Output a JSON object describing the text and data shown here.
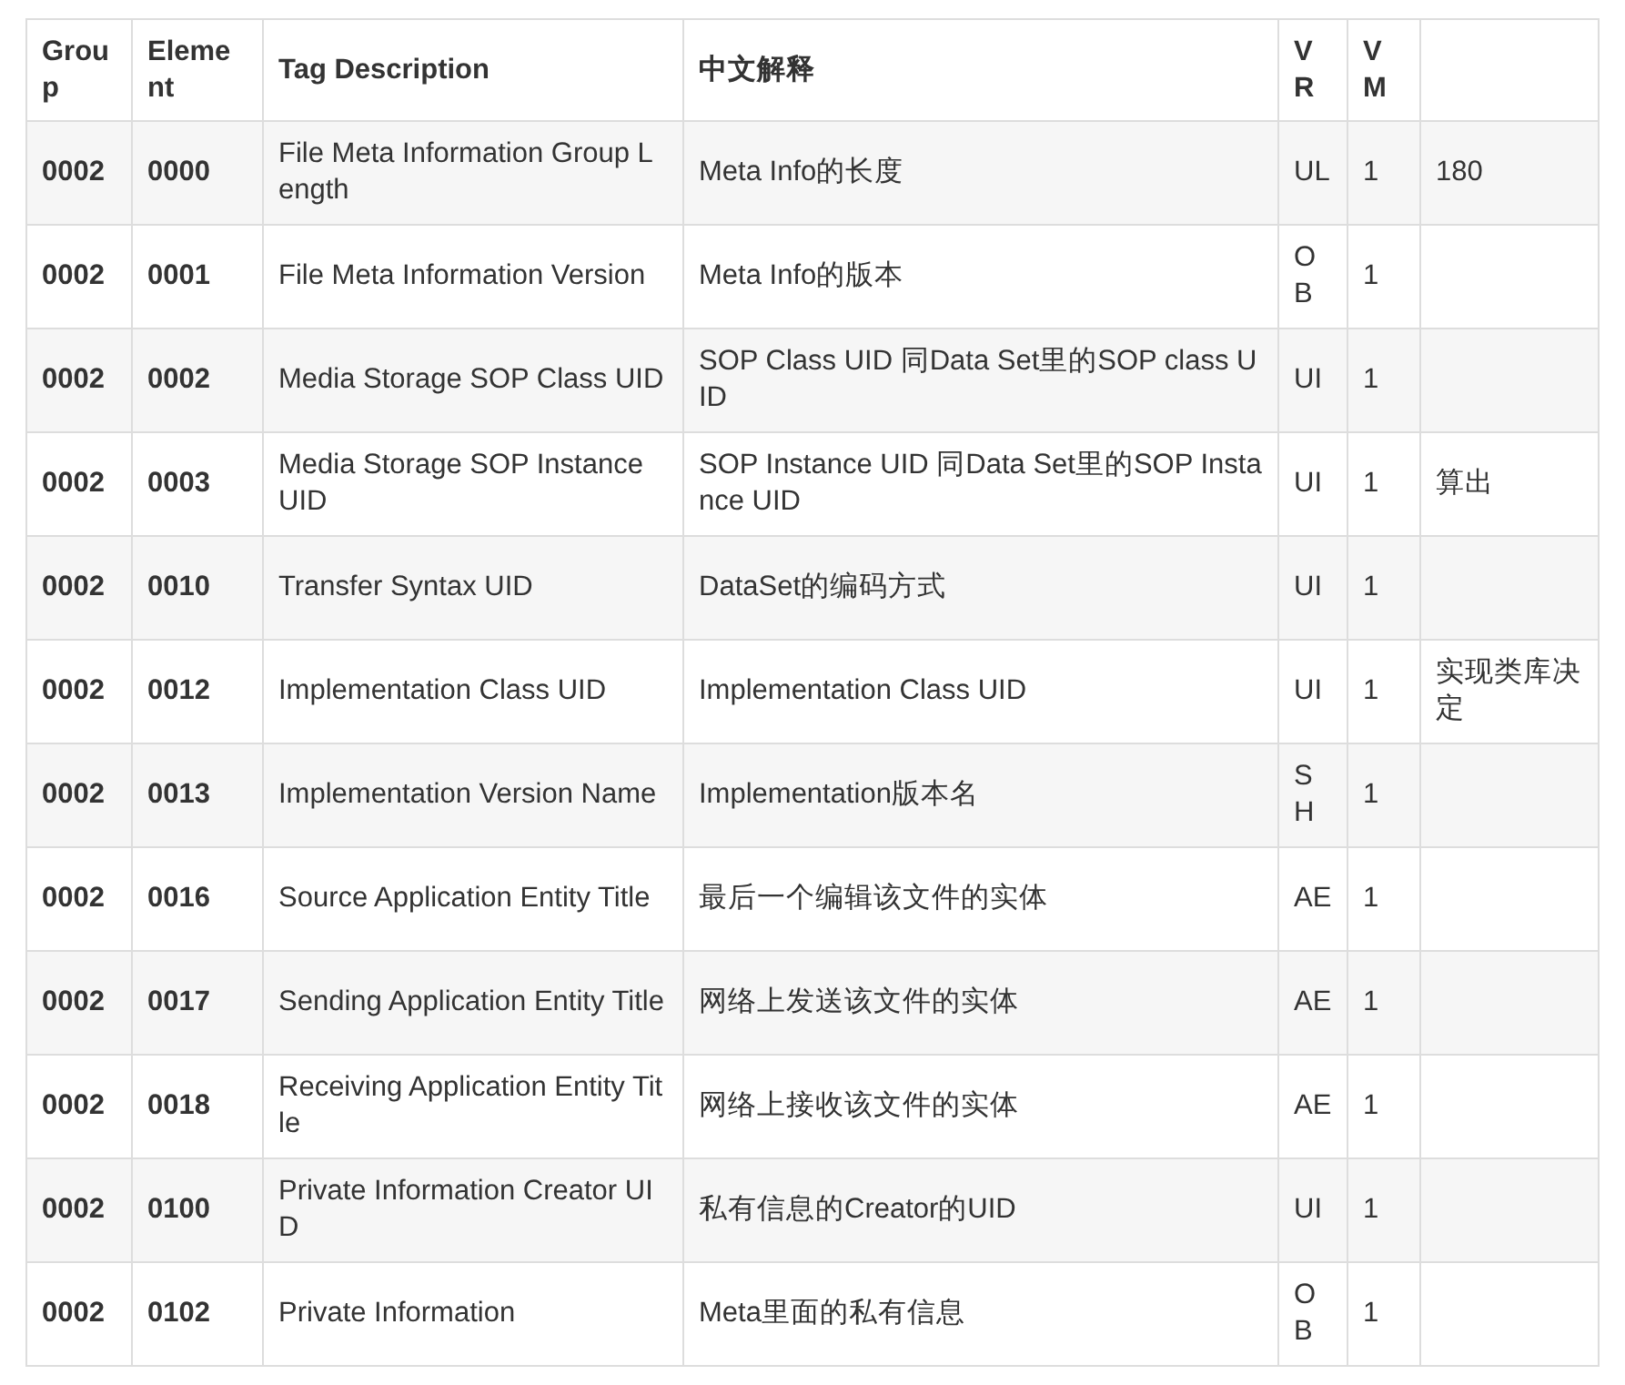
{
  "table": {
    "columns": [
      "Group",
      "Element",
      "Tag Description",
      "中文解释",
      "VR",
      "VM",
      ""
    ],
    "rows": [
      [
        "0002",
        "0000",
        "File Meta Information Group Length",
        "Meta Info的长度",
        "UL",
        "1",
        "180"
      ],
      [
        "0002",
        "0001",
        "File Meta Information Version",
        "Meta Info的版本",
        "OB",
        "1",
        ""
      ],
      [
        "0002",
        "0002",
        "Media Storage SOP Class UID",
        "SOP Class UID 同Data Set里的SOP class UID",
        "UI",
        "1",
        ""
      ],
      [
        "0002",
        "0003",
        "Media Storage SOP Instance UID",
        "SOP Instance UID 同Data Set里的SOP Instance UID",
        "UI",
        "1",
        "算出"
      ],
      [
        "0002",
        "0010",
        "Transfer Syntax UID",
        "DataSet的编码方式",
        "UI",
        "1",
        ""
      ],
      [
        "0002",
        "0012",
        "Implementation Class UID",
        "Implementation Class UID",
        "UI",
        "1",
        "实现类库决定"
      ],
      [
        "0002",
        "0013",
        "Implementation Version Name",
        "Implementation版本名",
        "SH",
        "1",
        ""
      ],
      [
        "0002",
        "0016",
        "Source Application Entity Title",
        "最后一个编辑该文件的实体",
        "AE",
        "1",
        ""
      ],
      [
        "0002",
        "0017",
        "Sending Application Entity Title",
        "网络上发送该文件的实体",
        "AE",
        "1",
        ""
      ],
      [
        "0002",
        "0018",
        "Receiving Application Entity Title",
        "网络上接收该文件的实体",
        "AE",
        "1",
        ""
      ],
      [
        "0002",
        "0100",
        "Private Information Creator UID",
        "私有信息的Creator的UID",
        "UI",
        "1",
        ""
      ],
      [
        "0002",
        "0102",
        "Private Information",
        "Meta里面的私有信息",
        "OB",
        "1",
        ""
      ]
    ]
  }
}
